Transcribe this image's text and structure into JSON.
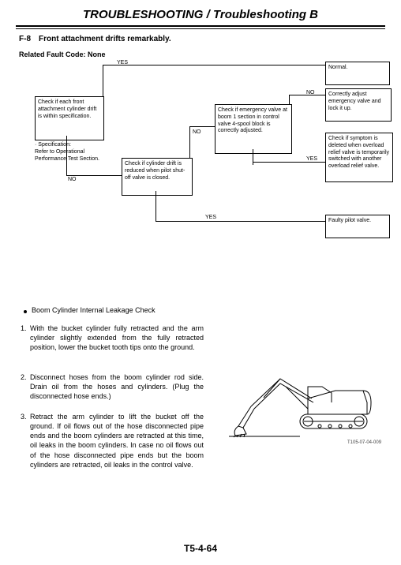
{
  "header": {
    "title": "TROUBLESHOOTING / Troubleshooting B",
    "section": "F-8 Front attachment drifts remarkably.",
    "related_code": "Related Fault Code: None"
  },
  "flow": {
    "box_a": "Check if each front attachment cylinder drift is within specification.",
    "spec_note": "· Specification:\nRefer to Operational Performance Test Section.",
    "box_b": "Check if cylinder drift is reduced when pilot shut-off valve is closed.",
    "box_c": "Check if emergency valve at boom 1 section in control valve 4-spool block is correctly adjusted.",
    "box_normal": "Normal.",
    "box_adjust": "Correctly adjust emergency valve and lock it up.",
    "box_overload": "Check if symptom is deleted when overload relief valve is temporarily switched with another overload relief valve.",
    "box_pilot": "Faulty pilot valve.",
    "yes": "YES",
    "no": "NO"
  },
  "leak_check": {
    "heading": "Boom Cylinder Internal Leakage Check",
    "steps": [
      "With the bucket cylinder fully retracted and the arm cylinder slightly extended from the fully retracted position, lower the bucket tooth tips onto the ground.",
      "Disconnect hoses from the boom cylinder rod side. Drain oil from the hoses and cylinders. (Plug the disconnected hose ends.)",
      "Retract the arm cylinder to lift the bucket off the ground. If oil flows out of the hose disconnected pipe ends and the boom cylinders are retracted at this time, oil leaks in the boom cylinders. In case no oil flows out of the hose disconnected pipe ends but the boom cylinders are retracted, oil leaks in the control valve."
    ]
  },
  "image_id": "T105-07-04-009",
  "page_number": "T5-4-64"
}
